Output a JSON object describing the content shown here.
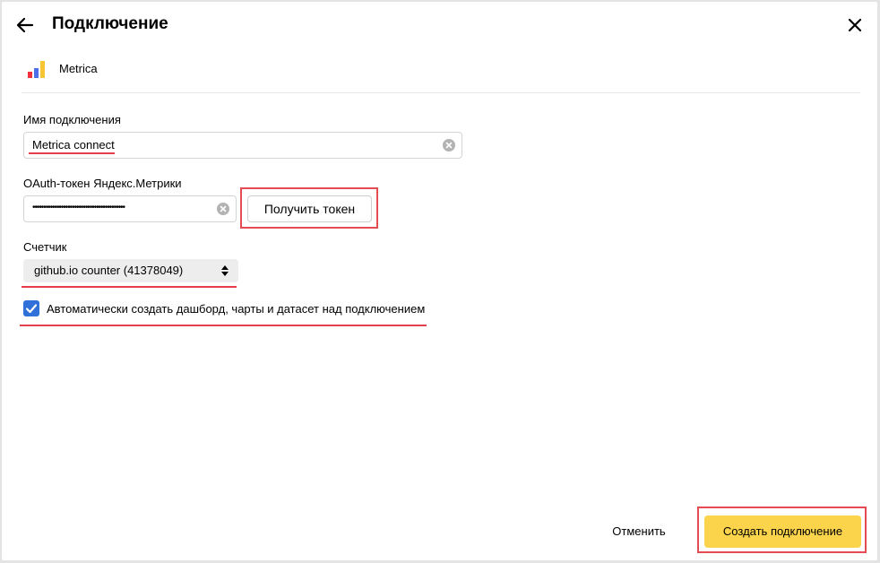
{
  "header": {
    "title": "Подключение",
    "back_icon": "arrow-left-icon",
    "close_icon": "close-icon"
  },
  "source": {
    "name": "Metrica",
    "logo_icon": "metrica-logo-icon",
    "logo_colors": [
      "#f3313d",
      "#4d70e8",
      "#f7c531"
    ]
  },
  "form": {
    "connection_name": {
      "label": "Имя подключения",
      "value": "Metrica connect"
    },
    "oauth_token": {
      "label": "OAuth-токен Яндекс.Метрики",
      "value_masked": "••••••••••••••••••••••••••••••••••••••••••",
      "get_token_label": "Получить токен"
    },
    "counter": {
      "label": "Счетчик",
      "selected": "github.io counter (41378049)"
    },
    "auto_create": {
      "checked": true,
      "label": "Автоматически создать дашборд, чарты и датасет над подключением"
    }
  },
  "footer": {
    "cancel_label": "Отменить",
    "create_label": "Создать подключение"
  },
  "colors": {
    "accent_yellow": "#fbd44b",
    "checkbox_blue": "#2f71d9",
    "annotation_red": "#e23e4b"
  }
}
